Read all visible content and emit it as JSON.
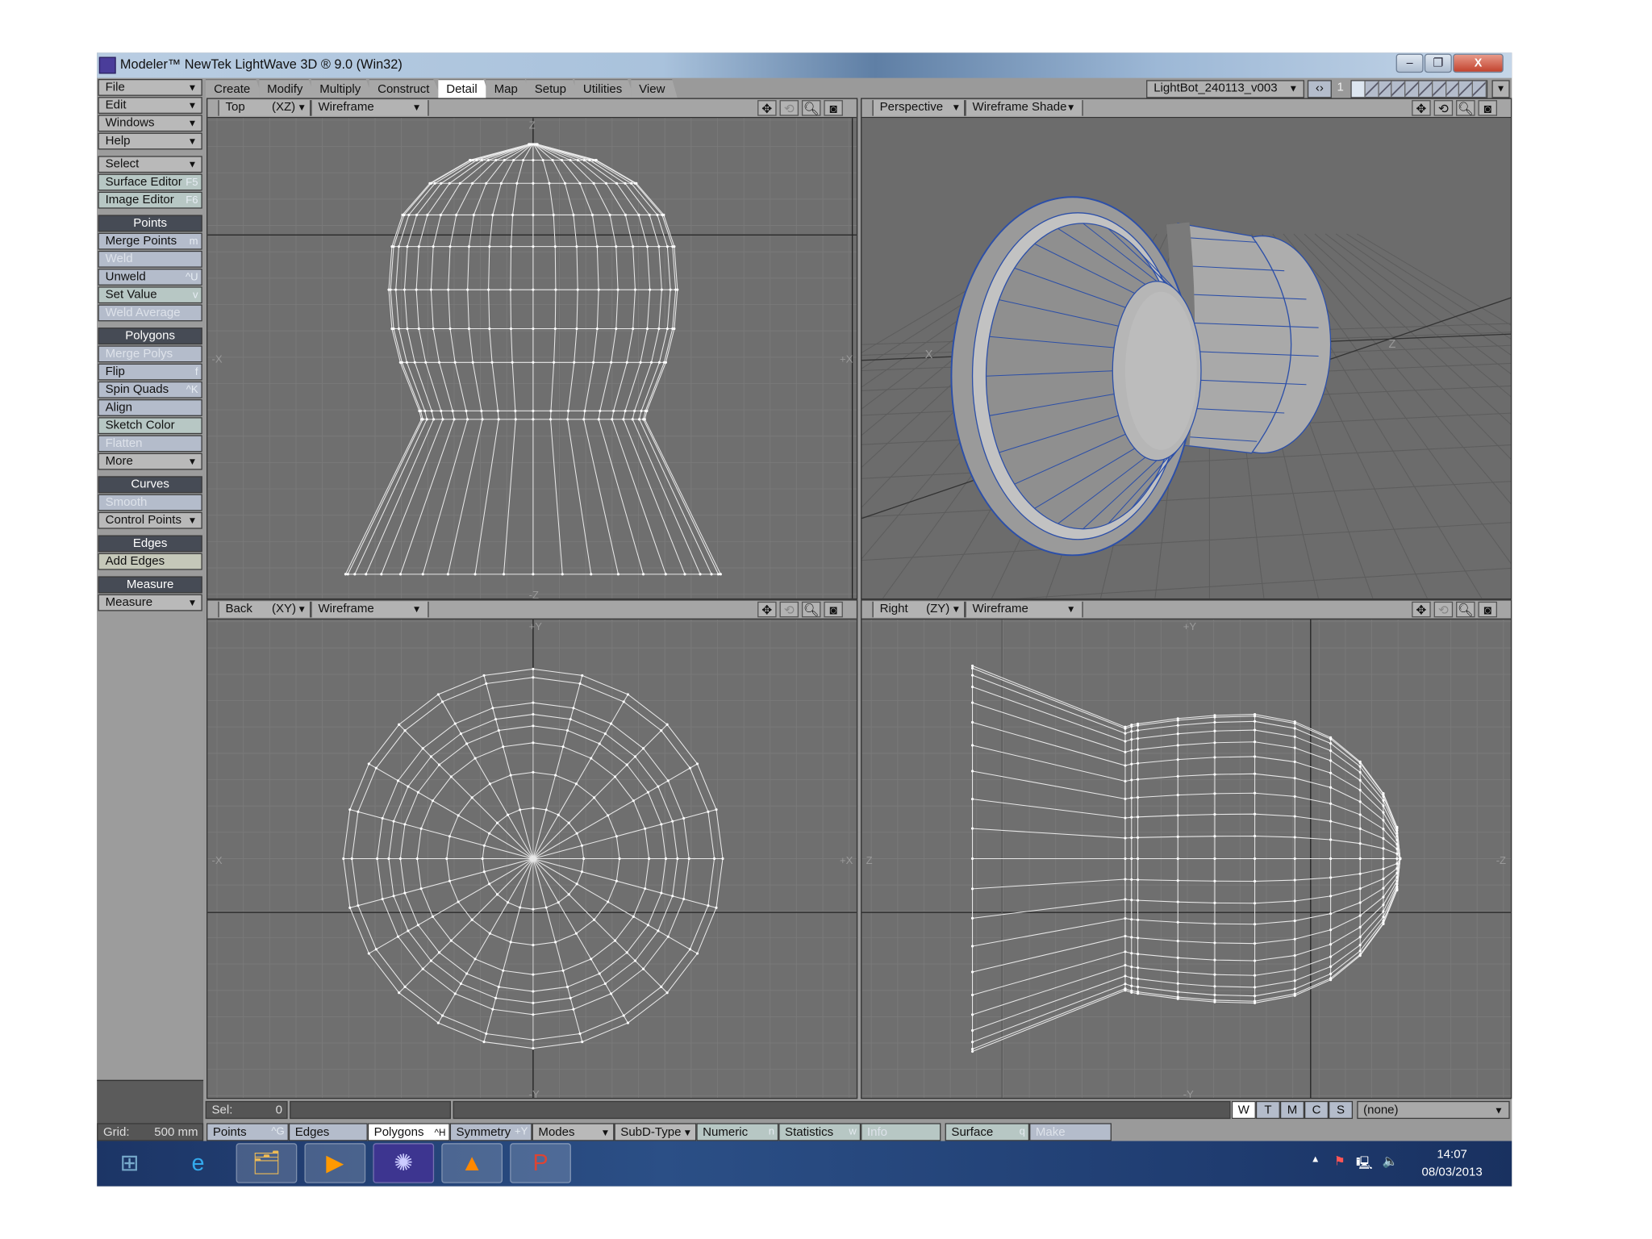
{
  "window": {
    "title": "Modeler™ NewTek LightWave 3D ® 9.0 (Win32)",
    "controls": [
      "–",
      "❐",
      "X"
    ]
  },
  "sidebar": [
    {
      "label": "File",
      "type": "dd"
    },
    {
      "label": "Edit",
      "type": "dd"
    },
    {
      "label": "Windows",
      "type": "dd"
    },
    {
      "label": "Help",
      "type": "dd"
    },
    {
      "gap": true
    },
    {
      "label": "Select",
      "type": "dd"
    },
    {
      "label": "Surface Editor",
      "type": "grn",
      "shortcut": "F5"
    },
    {
      "label": "Image Editor",
      "type": "grn",
      "shortcut": "F6"
    },
    {
      "gap": true
    },
    {
      "label": "Points",
      "type": "hdr"
    },
    {
      "label": "Merge Points",
      "type": "btn",
      "shortcut": "m"
    },
    {
      "label": "Weld",
      "type": "dis"
    },
    {
      "label": "Unweld",
      "type": "btn",
      "shortcut": "^U"
    },
    {
      "label": "Set Value",
      "type": "grn",
      "shortcut": "v"
    },
    {
      "label": "Weld Average",
      "type": "dis"
    },
    {
      "gap": true
    },
    {
      "label": "Polygons",
      "type": "hdr"
    },
    {
      "label": "Merge Polys",
      "type": "dis"
    },
    {
      "label": "Flip",
      "type": "btn",
      "shortcut": "f"
    },
    {
      "label": "Spin Quads",
      "type": "btn",
      "shortcut": "^K"
    },
    {
      "label": "Align",
      "type": "btn"
    },
    {
      "label": "Sketch Color",
      "type": "grn"
    },
    {
      "label": "Flatten",
      "type": "dis"
    },
    {
      "label": "More",
      "type": "dd"
    },
    {
      "gap": true
    },
    {
      "label": "Curves",
      "type": "hdr"
    },
    {
      "label": "Smooth",
      "type": "dis"
    },
    {
      "label": "Control Points",
      "type": "dd"
    },
    {
      "gap": true
    },
    {
      "label": "Edges",
      "type": "hdr"
    },
    {
      "label": "Add Edges",
      "type": "ylw"
    },
    {
      "gap": true
    },
    {
      "label": "Measure",
      "type": "hdr"
    },
    {
      "label": "Measure",
      "type": "dd"
    }
  ],
  "tabs": [
    {
      "label": "Create"
    },
    {
      "label": "Modify"
    },
    {
      "label": "Multiply"
    },
    {
      "label": "Construct"
    },
    {
      "label": "Detail",
      "active": true
    },
    {
      "label": "Map"
    },
    {
      "label": "Setup"
    },
    {
      "label": "Utilities"
    },
    {
      "label": "View"
    }
  ],
  "object": {
    "name": "LightBot_240113_v003",
    "layer": "1"
  },
  "viewports": [
    {
      "view": "Top",
      "axes": "(XZ)",
      "mode": "Wireframe",
      "labels": [
        "Z",
        "-X",
        "+X",
        "-Z"
      ]
    },
    {
      "view": "Perspective",
      "axes": "",
      "mode": "Wireframe Shade",
      "labels": [
        "X",
        "Z"
      ]
    },
    {
      "view": "Back",
      "axes": "(XY)",
      "mode": "Wireframe",
      "labels": [
        "+Y",
        "-X",
        "+X",
        "-Y"
      ]
    },
    {
      "view": "Right",
      "axes": "(ZY)",
      "mode": "Wireframe",
      "labels": [
        "+Y",
        "Z",
        "-Z",
        "-Y"
      ]
    }
  ],
  "status": {
    "sel_label": "Sel:",
    "sel_value": "0",
    "wtmcs": [
      "W",
      "T",
      "M",
      "C",
      "S"
    ],
    "surface": "(none)"
  },
  "bottom": {
    "grid_label": "Grid:",
    "grid_value": "500 mm",
    "buttons": [
      {
        "label": "Points",
        "shortcut": "^G"
      },
      {
        "label": "Edges",
        "shortcut": ""
      },
      {
        "label": "Polygons",
        "shortcut": "^H",
        "active": true
      },
      {
        "label": "Symmetry",
        "shortcut": "+Y"
      },
      {
        "label": "Modes",
        "shortcut": "▼"
      },
      {
        "label": "SubD-Type",
        "shortcut": "▼"
      },
      {
        "label": "Numeric",
        "shortcut": "n"
      },
      {
        "label": "Statistics",
        "shortcut": "w"
      },
      {
        "label": "Info",
        "shortcut": "",
        "disabled": true
      },
      {
        "label": "Surface",
        "shortcut": "q"
      },
      {
        "label": "Make",
        "shortcut": "",
        "disabled": true
      }
    ]
  },
  "taskbar": {
    "time": "14:07",
    "date": "08/03/2013",
    "apps": [
      "start",
      "internet-explorer",
      "file-explorer",
      "media-player",
      "lightwave",
      "vlc",
      "powerpoint"
    ]
  }
}
